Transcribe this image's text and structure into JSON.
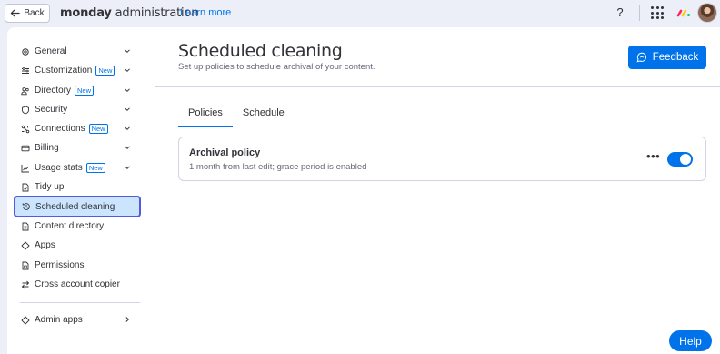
{
  "topbar": {
    "back_label": "Back",
    "app_name_bold": "monday",
    "app_name_rest": " administration",
    "learn_more": "Learn more",
    "help_icon": "?"
  },
  "sidebar": {
    "items": [
      {
        "label": "General",
        "icon": "gear-icon",
        "badge": "",
        "chevron": "down"
      },
      {
        "label": "Customization",
        "icon": "sliders-icon",
        "badge": "New",
        "chevron": "down"
      },
      {
        "label": "Directory",
        "icon": "people-icon",
        "badge": "New",
        "chevron": "down"
      },
      {
        "label": "Security",
        "icon": "shield-icon",
        "badge": "",
        "chevron": "down"
      },
      {
        "label": "Connections",
        "icon": "connections-icon",
        "badge": "New",
        "chevron": "down"
      },
      {
        "label": "Billing",
        "icon": "card-icon",
        "badge": "",
        "chevron": "down"
      },
      {
        "label": "Usage stats",
        "icon": "chart-icon",
        "badge": "New",
        "chevron": "down"
      },
      {
        "label": "Tidy up",
        "icon": "document-icon",
        "badge": "",
        "chevron": ""
      },
      {
        "label": "Scheduled cleaning",
        "icon": "history-icon",
        "badge": "",
        "chevron": ""
      },
      {
        "label": "Content directory",
        "icon": "folder-doc-icon",
        "badge": "",
        "chevron": ""
      },
      {
        "label": "Apps",
        "icon": "apps-icon",
        "badge": "",
        "chevron": ""
      },
      {
        "label": "Permissions",
        "icon": "lock-doc-icon",
        "badge": "",
        "chevron": ""
      },
      {
        "label": "Cross account copier",
        "icon": "swap-icon",
        "badge": "",
        "chevron": ""
      },
      {
        "label": "Admin apps",
        "icon": "apps-icon",
        "badge": "",
        "chevron": "right"
      }
    ],
    "active_item": "Scheduled cleaning"
  },
  "main": {
    "title": "Scheduled cleaning",
    "subtitle": "Set up policies to schedule archival of your content.",
    "feedback_label": "Feedback",
    "tabs": [
      {
        "label": "Policies",
        "active": true
      },
      {
        "label": "Schedule",
        "active": false
      }
    ],
    "policy": {
      "name": "Archival policy",
      "description": "1 month from last edit; grace period is enabled",
      "enabled": true,
      "more_label": "•••"
    }
  },
  "help_label": "Help",
  "colors": {
    "accent": "#0073ea",
    "active_nav_bg": "#cce5ff",
    "active_nav_border": "#5559df",
    "page_bg": "#eceff8"
  }
}
